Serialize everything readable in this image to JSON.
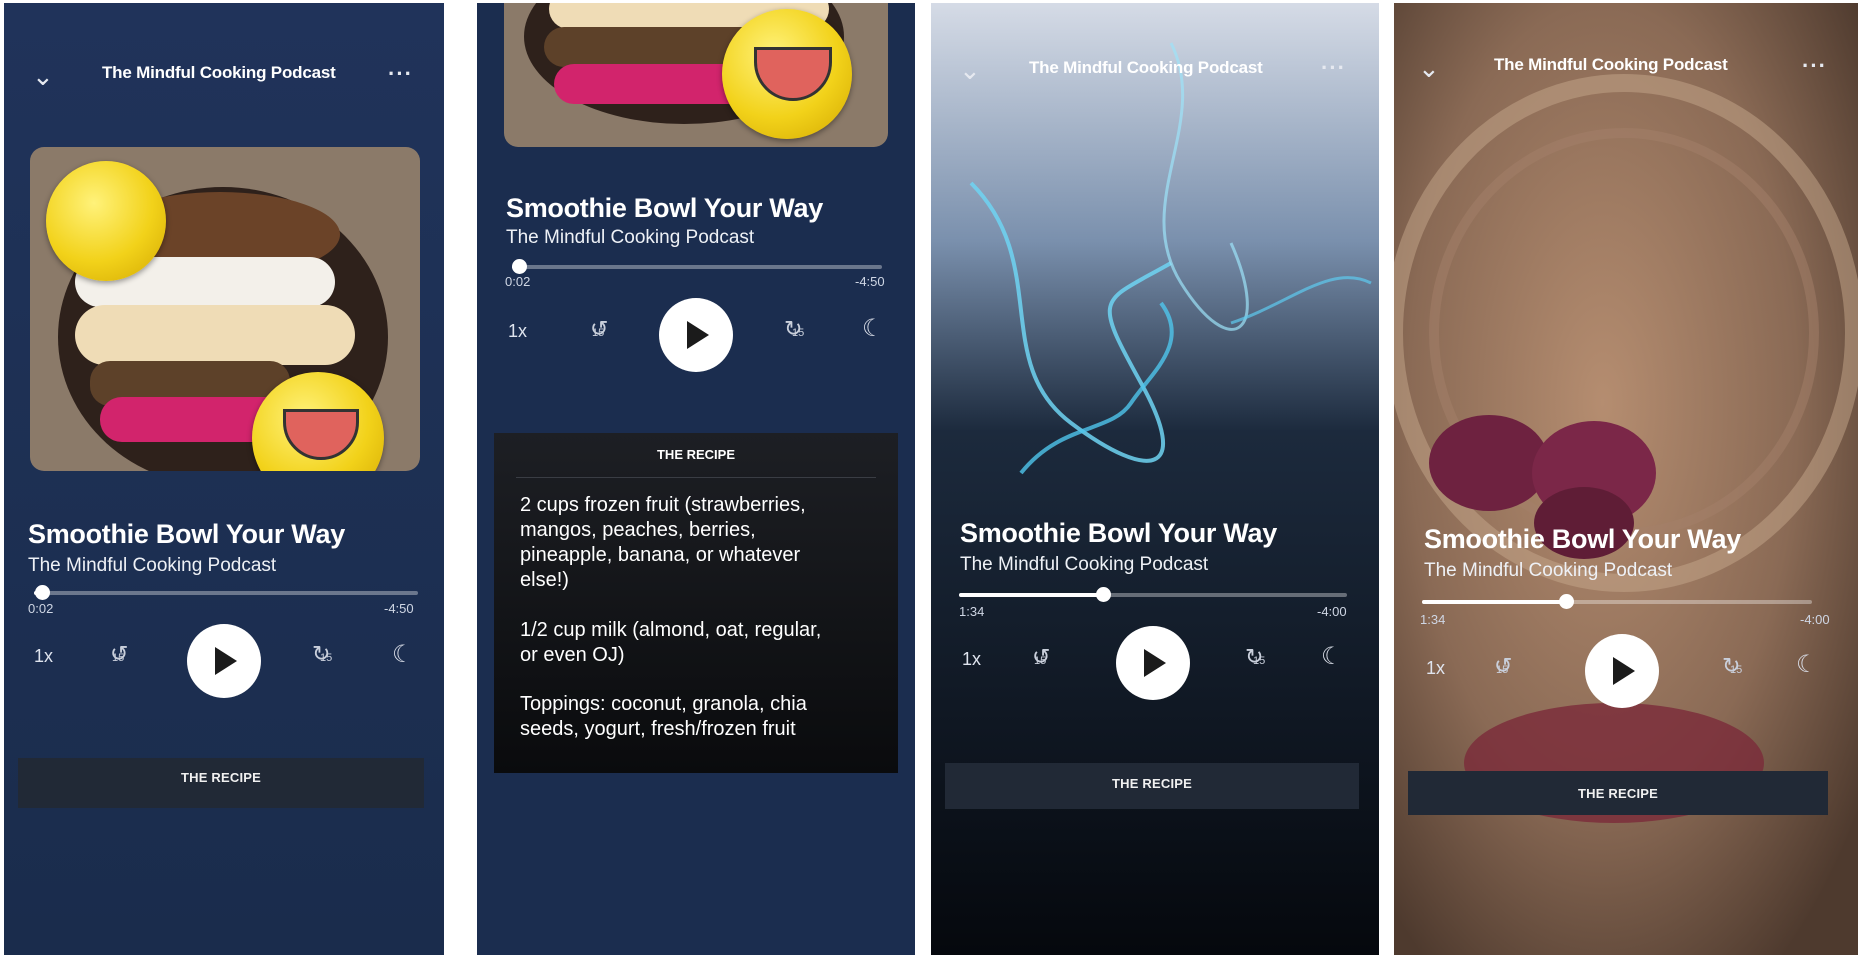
{
  "podcast_name": "The Mindful Cooking Podcast",
  "episode_title": "Smoothie Bowl Your Way",
  "speed": "1x",
  "skip_seconds": "15",
  "recipe_tab_label": "THE RECIPE",
  "recipe_panel": {
    "heading": "THE RECIPE",
    "paragraphs": [
      "2 cups frozen fruit (strawberries, mangos, peaches, berries, pineapple, banana, or whatever else!)",
      "1/2 cup milk (almond, oat, regular, or even OJ)",
      "Toppings: coconut, granola, chia seeds, yogurt, fresh/frozen fruit"
    ]
  },
  "screens": [
    {
      "elapsed": "0:02",
      "remaining": "-4:50",
      "progress": 0.02
    },
    {
      "elapsed": "0:02",
      "remaining": "-4:50",
      "progress": 0.02
    },
    {
      "elapsed": "1:34",
      "remaining": "-4:00",
      "progress": 0.37
    },
    {
      "elapsed": "1:34",
      "remaining": "-4:00",
      "progress": 0.37
    }
  ],
  "icons": {
    "collapse": "chevron-down-icon",
    "more": "more-icon",
    "rewind": "rewind-15-icon",
    "forward": "forward-15-icon",
    "play": "play-icon",
    "sleep": "moon-icon"
  }
}
